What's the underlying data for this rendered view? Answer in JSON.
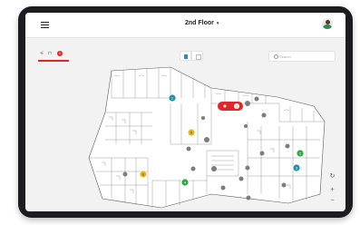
{
  "header": {
    "floor_title": "2nd Floor",
    "floor_chevron": "▾"
  },
  "filter_bar": {
    "filter_icons": [
      "sliders-icon",
      "badge-icon"
    ],
    "badge_count": "1"
  },
  "view_toggle": {
    "options": [
      "map-view",
      "grid-view"
    ],
    "active": "map-view"
  },
  "search": {
    "placeholder": "Search",
    "value": ""
  },
  "map_pins": [
    {
      "label": "1",
      "color": "#1e93a4"
    },
    {
      "label": "2",
      "color": "#2fab3d"
    },
    {
      "label": "3",
      "color": "#1e93a4"
    },
    {
      "label": "4",
      "color": "#2fab3d"
    },
    {
      "label": "5",
      "color": "#e8b51c"
    },
    {
      "label": "6",
      "color": "#e8b51c"
    }
  ],
  "alert_pin": {
    "label": "1",
    "color": "#e0262b"
  },
  "zoom_controls": {
    "reset": "↻",
    "zoom_in": "+",
    "zoom_out": "−"
  },
  "colors": {
    "accent_red": "#e0262b",
    "teal": "#1e93a4",
    "green": "#2fab3d",
    "yellow": "#e8b51c",
    "device_frame": "#1d1d1f",
    "wall": "#444444"
  }
}
